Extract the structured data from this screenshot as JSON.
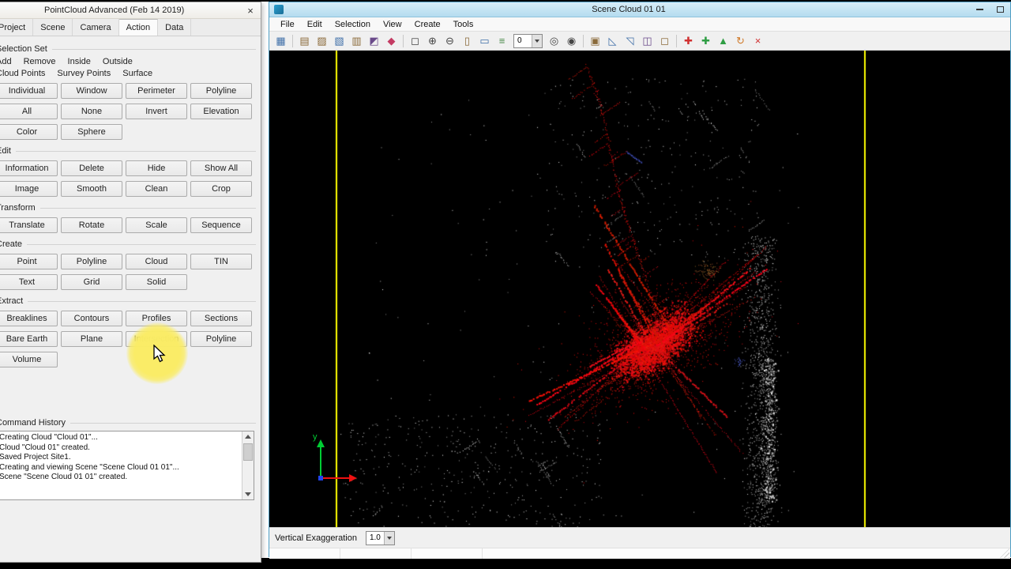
{
  "left_window": {
    "title": "PointCloud Advanced (Feb 14 2019)",
    "close_glyph": "×",
    "tabs": [
      {
        "label": "Project"
      },
      {
        "label": "Scene",
        "icon_color": "#c0512f"
      },
      {
        "label": "Camera",
        "icon_color": "#2aa9c9"
      },
      {
        "label": "Action",
        "icon_color": "#e8a33d",
        "active": true
      },
      {
        "label": "Data",
        "icon_color": "#3aa655"
      }
    ],
    "groups": {
      "selection_set": {
        "label": "Selection Set",
        "radio_row1": [
          {
            "label": "Add",
            "checked": false
          },
          {
            "label": "Remove",
            "checked": false
          },
          {
            "label": "Inside",
            "checked": true
          },
          {
            "label": "Outside",
            "checked": false
          }
        ],
        "radio_row2": [
          {
            "label": "Cloud Points",
            "checked": true
          },
          {
            "label": "Survey Points",
            "checked": false
          },
          {
            "label": "Surface",
            "checked": false
          }
        ],
        "buttons": [
          "Individual",
          "Window",
          "Perimeter",
          "Polyline",
          "All",
          "None",
          "Invert",
          "Elevation",
          "Color",
          "Sphere"
        ]
      },
      "edit": {
        "label": "Edit",
        "buttons": [
          "Information",
          "Delete",
          "Hide",
          "Show All",
          "Image",
          "Smooth",
          "Clean",
          "Crop"
        ]
      },
      "transform": {
        "label": "Transform",
        "buttons": [
          "Translate",
          "Rotate",
          "Scale",
          "Sequence"
        ]
      },
      "create": {
        "label": "Create",
        "buttons": [
          "Point",
          "Polyline",
          "Cloud",
          "TIN",
          "Text",
          "Grid",
          "Solid"
        ]
      },
      "extract": {
        "label": "Extract",
        "buttons": [
          "Breaklines",
          "Contours",
          "Profiles",
          "Sections",
          "Bare Earth",
          "Plane",
          "Intersection",
          "Polyline",
          "Volume"
        ]
      },
      "command_history": {
        "label": "Command History",
        "lines": [
          "Creating Cloud \"Cloud 01\"...",
          "Cloud \"Cloud 01\" created.",
          "Saved Project Site1.",
          "Creating and viewing Scene \"Scene Cloud 01 01\"...",
          "Scene \"Scene Cloud 01 01\" created."
        ]
      }
    }
  },
  "right_window": {
    "title": "Scene Cloud 01 01",
    "menus": [
      "File",
      "Edit",
      "Selection",
      "View",
      "Create",
      "Tools"
    ],
    "toolbar": {
      "icons_left": [
        {
          "name": "views-layout-icon",
          "glyph": "▦",
          "color": "#3f6fa8"
        },
        {
          "sep": true
        },
        {
          "name": "display-settings-icon",
          "glyph": "▤",
          "color": "#8a6a3a"
        },
        {
          "name": "point-display-icon",
          "glyph": "▨",
          "color": "#8a6a3a"
        },
        {
          "name": "cloud-display-icon",
          "glyph": "▧",
          "color": "#3f6fa8"
        },
        {
          "name": "scene-display-icon",
          "glyph": "▥",
          "color": "#8a6a3a"
        },
        {
          "name": "render-mode-icon",
          "glyph": "◩",
          "color": "#6a4a8a"
        },
        {
          "name": "clear-view-icon",
          "glyph": "◆",
          "color": "#c43b63"
        },
        {
          "sep": true
        },
        {
          "name": "zoom-window-icon",
          "glyph": "◻",
          "color": "#444444"
        },
        {
          "name": "zoom-in-icon",
          "glyph": "⊕",
          "color": "#444444"
        },
        {
          "name": "zoom-out-icon",
          "glyph": "⊖",
          "color": "#444444"
        },
        {
          "name": "page-view-icon",
          "glyph": "▯",
          "color": "#8a6a3a"
        },
        {
          "name": "measure-icon",
          "glyph": "▭",
          "color": "#3f6fa8"
        },
        {
          "name": "layers-icon",
          "glyph": "≡",
          "color": "#4a8a4a"
        }
      ],
      "dropdown_value": "0",
      "icons_right": [
        {
          "name": "zoom-extents-icon",
          "glyph": "◎",
          "color": "#444444"
        },
        {
          "name": "zoom-selected-icon",
          "glyph": "◉",
          "color": "#444444"
        },
        {
          "sep": true
        },
        {
          "name": "image-capture-icon",
          "glyph": "▣",
          "color": "#8a6a3a"
        },
        {
          "name": "profile-view-icon",
          "glyph": "◺",
          "color": "#3f6fa8"
        },
        {
          "name": "chart-view-icon",
          "glyph": "◹",
          "color": "#3f6fa8"
        },
        {
          "name": "section-view-icon",
          "glyph": "◫",
          "color": "#6a4a8a"
        },
        {
          "name": "grid-view-icon",
          "glyph": "◻",
          "color": "#8a6a3a"
        },
        {
          "sep": true
        },
        {
          "name": "add-point-icon",
          "glyph": "✚",
          "color": "#d03030"
        },
        {
          "name": "add-cloud-icon",
          "glyph": "✚",
          "color": "#2f9e44"
        },
        {
          "name": "pick-point-icon",
          "glyph": "▲",
          "color": "#2f9e44"
        },
        {
          "name": "rotate-view-icon",
          "glyph": "↻",
          "color": "#d07a2a"
        },
        {
          "name": "delete-selection-icon",
          "glyph": "×",
          "color": "#d03030"
        }
      ]
    },
    "viewport": {
      "background": "#000000",
      "guide_color": "#ffff00",
      "cloud_primary_color": "#ff0000",
      "cloud_secondary_color": "#c8c8c8",
      "y_axis_label": "y",
      "y_axis_color": "#00cc33",
      "x_axis_color": "#ee1111"
    },
    "bottom_bar": {
      "label": "Vertical Exaggeration",
      "value": "1.0"
    }
  }
}
